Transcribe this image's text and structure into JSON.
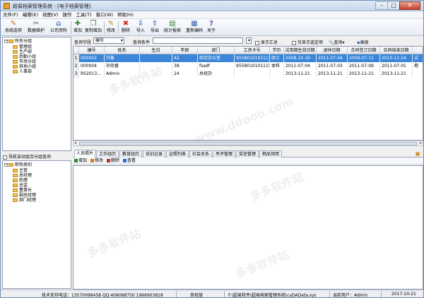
{
  "window": {
    "title": "超易档案管理系统 - [电子档案管理]",
    "controls": {
      "minimize": "–",
      "maximize": "□",
      "close": "✕"
    }
  },
  "menu": [
    "文件(F)",
    "编辑(E)",
    "视图(V)",
    "操作",
    "工具(T)",
    "窗口(W)",
    "帮助(H)"
  ],
  "toolbar": [
    {
      "label": "系统选项",
      "icon": "tools-icon",
      "glyph": "✎",
      "color": "#c07a10"
    },
    {
      "label": "数据维护",
      "icon": "wrench-icon",
      "glyph": "✂",
      "color": "#555555"
    },
    {
      "label": "公司资料",
      "icon": "company-icon",
      "glyph": "⌂",
      "color": "#2e6fbf"
    },
    {
      "label": "增加",
      "icon": "add-icon",
      "glyph": "✚",
      "color": "#2d8a2d"
    },
    {
      "label": "复制增加",
      "icon": "copy-add-icon",
      "glyph": "❐",
      "color": "#2d8a2d"
    },
    {
      "label": "修改",
      "icon": "edit-icon",
      "glyph": "✎",
      "color": "#d08010"
    },
    {
      "label": "删除",
      "icon": "delete-icon",
      "glyph": "✖",
      "color": "#c62a1c"
    },
    {
      "label": "导入",
      "icon": "import-icon",
      "glyph": "⇩",
      "color": "#2e6fbf"
    },
    {
      "label": "导出",
      "icon": "export-icon",
      "glyph": "⇧",
      "color": "#2e6fbf"
    },
    {
      "label": "统计报表",
      "icon": "report-icon",
      "glyph": "▤",
      "color": "#3d7d3d"
    },
    {
      "label": "重新编码",
      "icon": "recode-icon",
      "glyph": "▦",
      "color": "#3568a8"
    },
    {
      "label": "关于",
      "icon": "help-icon",
      "glyph": "?",
      "color": "#7a3fb0"
    }
  ],
  "org_tree": {
    "root": "所有分组",
    "children": [
      "管理组",
      "生产部",
      "后勤小组",
      "市场分组",
      "其他小组",
      "人事部"
    ]
  },
  "left_option": "导航自动组合分组查询",
  "category_tree": {
    "root": "职务类别",
    "children": [
      "主管",
      "总经理",
      "助理",
      "总监",
      "董事长",
      "副总经理",
      "部门经理"
    ]
  },
  "query": {
    "field_label": "查询字段",
    "field_value": "编号",
    "condition_label": "查询条件",
    "summary_label": "显示汇总",
    "select_label": "仅显示选定项",
    "search_button": "查询",
    "advanced_button": "高级"
  },
  "grid": {
    "columns": [
      "编号",
      "姓名",
      "生日",
      "年龄",
      "部门",
      "工资卡号",
      "学历",
      "试用期生效日期",
      "退休日期",
      "合同签订日期",
      "合同结束日期"
    ],
    "rows": [
      {
        "n": "1",
        "cells": [
          "000002",
          "刘备",
          "",
          "42",
          "综合办公室",
          "9558010101111",
          "硕士",
          "2008-10-19",
          "2011-07-04",
          "2009-07-11",
          "2010-12-24"
        ],
        "extra": "试"
      },
      {
        "n": "2",
        "cells": [
          "000004",
          "孙尚香",
          "",
          "38",
          "fsadf",
          "9558010101115",
          "本科",
          "2011-07-04",
          "2011-07-03",
          "2011-07-09",
          "2011-07-01"
        ],
        "extra": "假"
      },
      {
        "n": "3",
        "cells": [
          "RS2013...",
          "Admin",
          "",
          "24",
          "总经办",
          "",
          "",
          "2013-11-21",
          "2013-11-21",
          "2013-11-21",
          "2013-11-21"
        ],
        "extra": ""
      }
    ]
  },
  "tabs": [
    "人员照片",
    "工作经历",
    "教育经历",
    "培训记录",
    "证照列表",
    "社会关系",
    "考评管理",
    "奖惩管理",
    "物品领用"
  ],
  "detail_toolbar": [
    "增加",
    "修改",
    "删除",
    "查看"
  ],
  "status": {
    "support": "技术支持电话：13570098458 QQ:408088750 1966903818",
    "mode": "单机版",
    "db_path": "F:\\超易软件\\超易档案管理系统\\cyDAData.sys",
    "user": "当前用户：Admin",
    "date": "2017-10-21"
  },
  "watermark": [
    "多多软件站",
    "www.ddooo.com"
  ]
}
